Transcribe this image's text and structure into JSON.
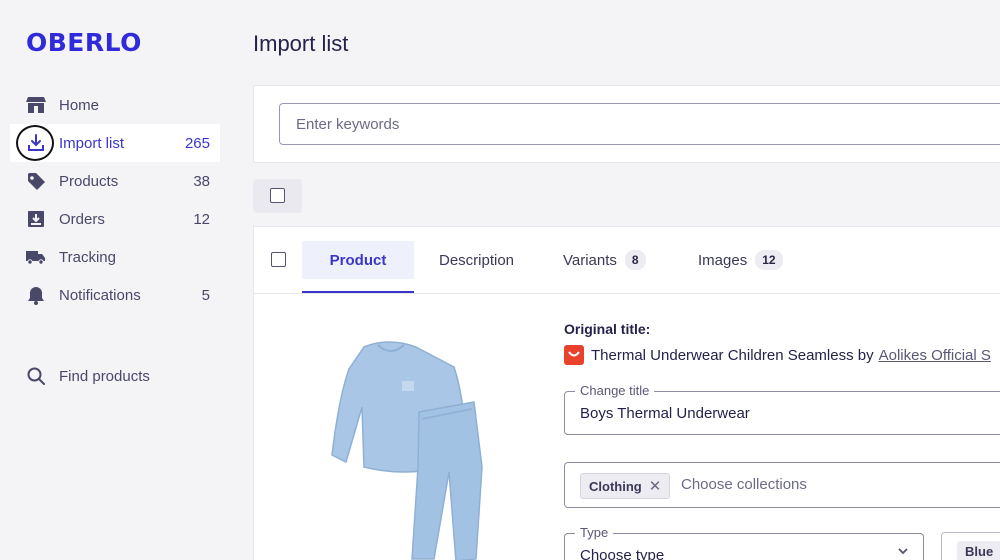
{
  "brand": {
    "logo": "OBERLO",
    "accent": "#2f2bdb"
  },
  "header": {
    "title": "Import list"
  },
  "sidebar": {
    "items": [
      {
        "label": "Home",
        "count": "",
        "icon": "store-icon"
      },
      {
        "label": "Import list",
        "count": "265",
        "icon": "import-icon",
        "active": true
      },
      {
        "label": "Products",
        "count": "38",
        "icon": "tag-icon"
      },
      {
        "label": "Orders",
        "count": "12",
        "icon": "orders-icon"
      },
      {
        "label": "Tracking",
        "count": "",
        "icon": "truck-icon"
      },
      {
        "label": "Notifications",
        "count": "5",
        "icon": "bell-icon"
      }
    ],
    "find": {
      "label": "Find products",
      "icon": "search-icon"
    }
  },
  "search": {
    "placeholder": "Enter keywords",
    "value": ""
  },
  "product": {
    "tabs": [
      {
        "label": "Product",
        "badge": ""
      },
      {
        "label": "Description",
        "badge": ""
      },
      {
        "label": "Variants",
        "badge": "8"
      },
      {
        "label": "Images",
        "badge": "12"
      }
    ],
    "original_title_label": "Original title:",
    "original_title": "Thermal Underwear Children Seamless by",
    "store_name": "Aolikes Official S",
    "change_title_label": "Change title",
    "change_title_value": "Boys Thermal Underwear",
    "collection_chip": "Clothing",
    "collections_placeholder": "Choose collections",
    "type_label": "Type",
    "type_value": "Choose type",
    "tag_chip": "Blue",
    "image_alt": "light blue children's thermal underwear set"
  }
}
